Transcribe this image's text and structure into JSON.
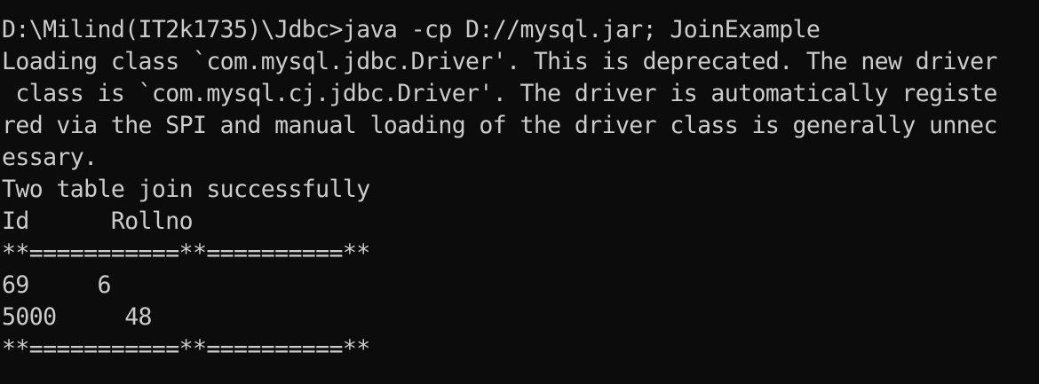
{
  "terminal": {
    "lines": [
      "D:\\Milind(IT2k1735)\\Jdbc>java -cp D://mysql.jar; JoinExample",
      "Loading class `com.mysql.jdbc.Driver'. This is deprecated. The new driver",
      " class is `com.mysql.cj.jdbc.Driver'. The driver is automatically registe",
      "red via the SPI and manual loading of the driver class is generally unnec",
      "essary.",
      "Two table join successfully",
      "Id      Rollno",
      "**===========**==========**",
      "69     6",
      "5000     48",
      "**===========**==========**"
    ]
  },
  "colors": {
    "background": "#0c0c0c",
    "foreground": "#cccccc"
  }
}
